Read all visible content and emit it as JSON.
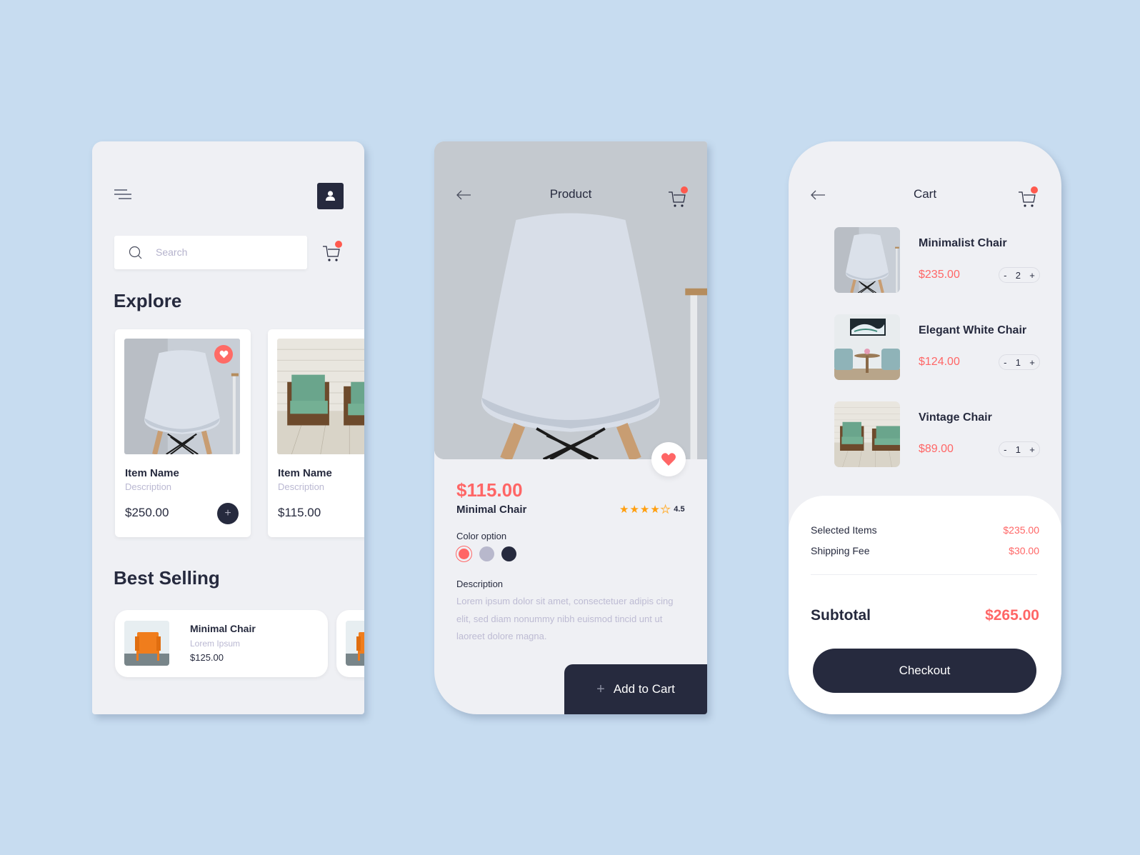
{
  "colors": {
    "background": "#c7dcf0",
    "screen": "#eff0f4",
    "dark": "#262a3e",
    "accent": "#ff6666",
    "badge": "#ff5a4e",
    "star": "#ff9f0f"
  },
  "explore_screen": {
    "search": {
      "placeholder": "Search"
    },
    "explore_title": "Explore",
    "items": [
      {
        "name": "Item Name",
        "description": "Description",
        "price": "$250.00",
        "image": "white-shell-chair",
        "favorite": true
      },
      {
        "name": "Item Name",
        "description": "Description",
        "price": "$115.00",
        "image": "green-armchairs",
        "favorite": false
      }
    ],
    "best_selling_title": "Best Selling",
    "best_selling": [
      {
        "name": "Minimal Chair",
        "description": "Lorem Ipsum",
        "price": "$125.00",
        "image": "orange-chair"
      }
    ]
  },
  "product_screen": {
    "title": "Product",
    "price": "$115.00",
    "name": "Minimal Chair",
    "rating": "4.5",
    "rating_value": 4.5,
    "rating_max": 5,
    "color_option_label": "Color option",
    "color_options": [
      {
        "name": "coral",
        "hex": "#ff6666",
        "selected": true
      },
      {
        "name": "lavender-gray",
        "hex": "#b8b8cc",
        "selected": false
      },
      {
        "name": "navy",
        "hex": "#262a3e",
        "selected": false
      }
    ],
    "description_label": "Description",
    "description": "Lorem ipsum dolor sit amet, consectetuer adipis cing elit, sed diam nonummy nibh euismod tincid unt ut laoreet dolore magna.",
    "add_to_cart_label": "Add to Cart"
  },
  "cart_screen": {
    "title": "Cart",
    "items": [
      {
        "name": "Minimalist Chair",
        "price": "$235.00",
        "quantity": "2",
        "image": "white-shell-chair"
      },
      {
        "name": "Elegant White Chair",
        "price": "$124.00",
        "quantity": "1",
        "image": "blue-tufted-chairs"
      },
      {
        "name": "Vintage Chair",
        "price": "$89.00",
        "quantity": "1",
        "image": "green-armchairs"
      }
    ],
    "qty_minus": "-",
    "qty_plus": "+",
    "summary": {
      "selected_items_label": "Selected Items",
      "selected_items_value": "$235.00",
      "shipping_label": "Shipping Fee",
      "shipping_value": "$30.00",
      "subtotal_label": "Subtotal",
      "subtotal_value": "$265.00"
    },
    "checkout_label": "Checkout"
  }
}
